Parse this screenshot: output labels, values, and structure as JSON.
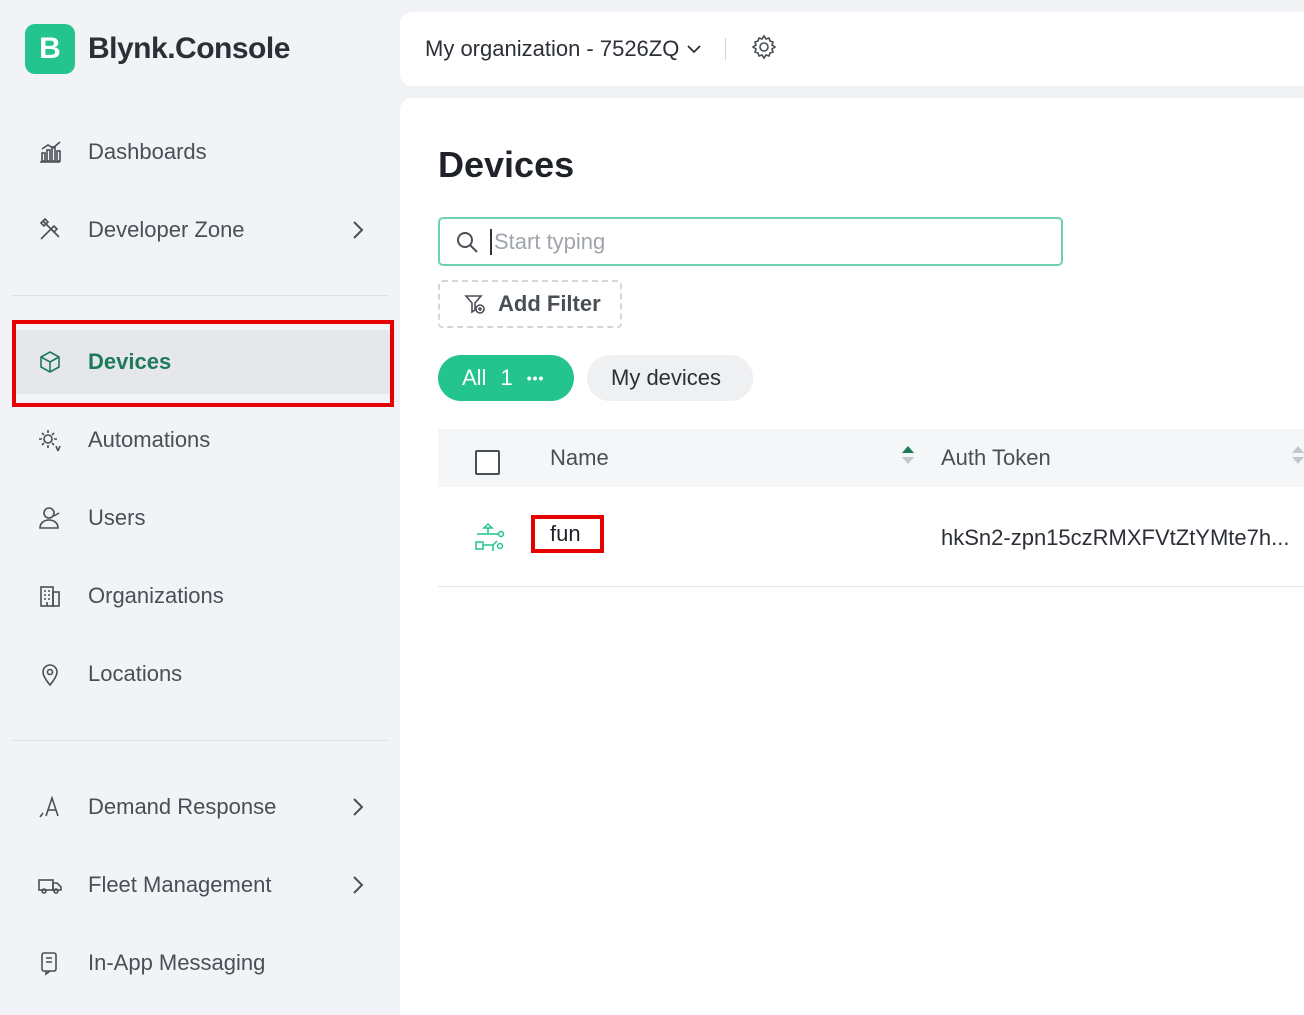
{
  "brand": {
    "badge": "B",
    "name": "Blynk.Console"
  },
  "sidebar": {
    "items": [
      {
        "label": "Dashboards"
      },
      {
        "label": "Developer Zone"
      },
      {
        "label": "Devices"
      },
      {
        "label": "Automations"
      },
      {
        "label": "Users"
      },
      {
        "label": "Organizations"
      },
      {
        "label": "Locations"
      },
      {
        "label": "Demand Response"
      },
      {
        "label": "Fleet Management"
      },
      {
        "label": "In-App Messaging"
      }
    ]
  },
  "topbar": {
    "org_name": "My organization - 7526ZQ"
  },
  "main": {
    "title": "Devices",
    "search_placeholder": "Start typing",
    "add_filter_label": "Add Filter",
    "pills": {
      "all_label": "All",
      "all_count": "1",
      "all_more": "•••",
      "mine_label": "My devices"
    },
    "table": {
      "headers": {
        "name": "Name",
        "token": "Auth Token"
      },
      "rows": [
        {
          "name": "fun",
          "token": "hkSn2-zpn15czRMXFVtZtYMte7h..."
        }
      ]
    }
  },
  "colors": {
    "accent": "#23c48e",
    "active_text": "#1d7a5a",
    "highlight": "#e60000"
  }
}
